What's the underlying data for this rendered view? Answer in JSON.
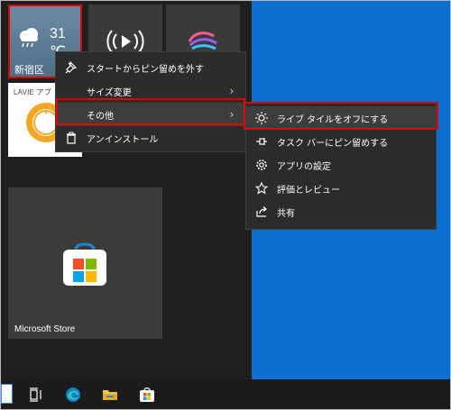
{
  "tiles": {
    "weather": {
      "temperature": "31 ℃",
      "location": "新宿区"
    },
    "lavie": {
      "label": "LAVIE アプ"
    },
    "store": {
      "label": "Microsoft Store"
    }
  },
  "context_menu": {
    "items": [
      {
        "icon": "unpin-icon",
        "label": "スタートからピン留めを外す",
        "has_submenu": false
      },
      {
        "icon": "",
        "label": "サイズ変更",
        "has_submenu": true
      },
      {
        "icon": "",
        "label": "その他",
        "has_submenu": true,
        "active": true
      },
      {
        "icon": "trash-icon",
        "label": "アンインストール",
        "has_submenu": false
      }
    ]
  },
  "submenu": {
    "items": [
      {
        "icon": "live-tile-icon",
        "label": "ライブ タイルをオフにする",
        "active": true
      },
      {
        "icon": "pin-icon",
        "label": "タスク バーにピン留めする"
      },
      {
        "icon": "gear-icon",
        "label": "アプリの設定"
      },
      {
        "icon": "star-edit-icon",
        "label": "評価とレビュー"
      },
      {
        "icon": "share-icon",
        "label": "共有"
      }
    ]
  },
  "taskbar": {
    "icons": [
      "task-view-icon",
      "edge-icon",
      "file-explorer-icon",
      "store-icon"
    ]
  },
  "colors": {
    "highlight_border": "#e00000",
    "desktop": "#0a6fd0",
    "menu_bg": "#2b2b2b"
  }
}
